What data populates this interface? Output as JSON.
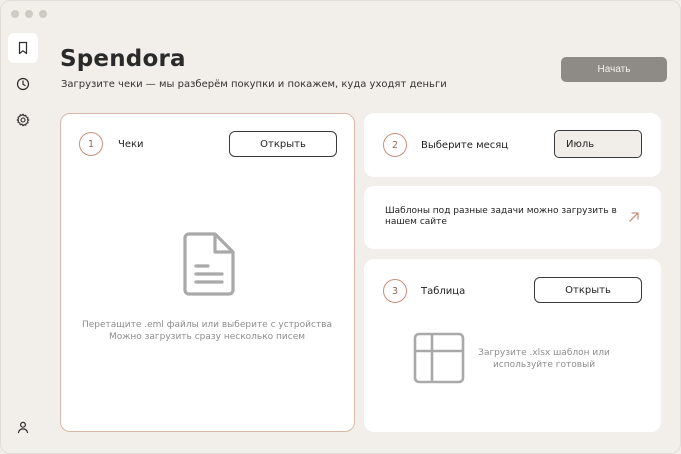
{
  "app": {
    "title": "Spendora",
    "subtitle": "Загрузите чеки — мы разберём покупки и покажем, куда уходят деньги",
    "start_label": "Начать"
  },
  "sidebar": {
    "items": [
      {
        "icon": "bookmark-icon",
        "active": true
      },
      {
        "icon": "clock-icon",
        "active": false
      },
      {
        "icon": "gear-icon",
        "active": false
      }
    ],
    "bottom_icon": "user-icon"
  },
  "receipts": {
    "step": "1",
    "label": "Чеки",
    "open_label": "Открыть",
    "hint_line1": "Перетащите .eml файлы или выберите с устройства",
    "hint_line2": "Можно загрузить сразу несколько писем"
  },
  "month": {
    "step": "2",
    "label": "Выберите месяц",
    "selected": "Июль"
  },
  "templates_link": {
    "text": "Шаблоны под разные задачи можно загрузить в нашем сайте"
  },
  "table": {
    "step": "3",
    "label": "Таблица",
    "open_label": "Открыть",
    "hint_line1": "Загрузите .xlsx шаблон или",
    "hint_line2": "используйте готовый"
  },
  "colors": {
    "accent": "#c98f7a",
    "start_button": "#8e8a86",
    "background": "#f2efea"
  }
}
